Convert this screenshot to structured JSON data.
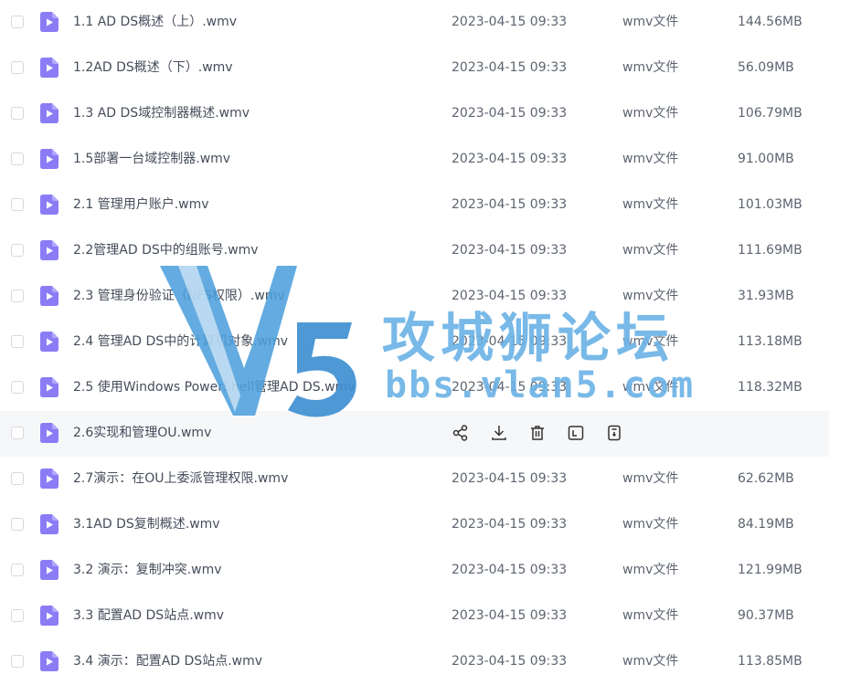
{
  "files": [
    {
      "name": "1.1 AD DS概述（上）.wmv",
      "date": "2023-04-15 09:33",
      "type": "wmv文件",
      "size": "144.56MB"
    },
    {
      "name": "1.2AD DS概述（下）.wmv",
      "date": "2023-04-15 09:33",
      "type": "wmv文件",
      "size": "56.09MB"
    },
    {
      "name": "1.3 AD DS域控制器概述.wmv",
      "date": "2023-04-15 09:33",
      "type": "wmv文件",
      "size": "106.79MB"
    },
    {
      "name": "1.5部署一台域控制器.wmv",
      "date": "2023-04-15 09:33",
      "type": "wmv文件",
      "size": "91.00MB"
    },
    {
      "name": "2.1 管理用户账户.wmv",
      "date": "2023-04-15 09:33",
      "type": "wmv文件",
      "size": "101.03MB"
    },
    {
      "name": "2.2管理AD DS中的组账号.wmv",
      "date": "2023-04-15 09:33",
      "type": "wmv文件",
      "size": "111.69MB"
    },
    {
      "name": "2.3 管理身份验证（NFS权限）.wmv",
      "date": "2023-04-15 09:33",
      "type": "wmv文件",
      "size": "31.93MB"
    },
    {
      "name": "2.4 管理AD DS中的计算机对象.wmv",
      "date": "2023-04-15 09:33",
      "type": "wmv文件",
      "size": "113.18MB"
    },
    {
      "name": "2.5 使用Windows PowerShell管理AD DS.wmv",
      "date": "2023-04-15 09:33",
      "type": "wmv文件",
      "size": "118.32MB"
    },
    {
      "name": "2.6实现和管理OU.wmv",
      "date": "",
      "type": "",
      "size": ""
    },
    {
      "name": "2.7演示：在OU上委派管理权限.wmv",
      "date": "2023-04-15 09:33",
      "type": "wmv文件",
      "size": "62.62MB"
    },
    {
      "name": "3.1AD DS复制概述.wmv",
      "date": "2023-04-15 09:33",
      "type": "wmv文件",
      "size": "84.19MB"
    },
    {
      "name": "3.2 演示：复制冲突.wmv",
      "date": "2023-04-15 09:33",
      "type": "wmv文件",
      "size": "121.99MB"
    },
    {
      "name": "3.3 配置AD DS站点.wmv",
      "date": "2023-04-15 09:33",
      "type": "wmv文件",
      "size": "90.37MB"
    },
    {
      "name": "3.4 演示：配置AD DS站点.wmv",
      "date": "2023-04-15 09:33",
      "type": "wmv文件",
      "size": "113.85MB"
    }
  ],
  "hover_row_actions": [
    "share-icon",
    "download-icon",
    "delete-icon",
    "rename-icon",
    "move-icon"
  ],
  "watermark": {
    "title": "攻城狮论坛",
    "url": "bbs.vlan5.com",
    "color": "#6ab2e6"
  },
  "colors": {
    "file_icon": "#8b7cf6",
    "text": "#454d5a",
    "hover_bg": "#f6f7f9"
  }
}
